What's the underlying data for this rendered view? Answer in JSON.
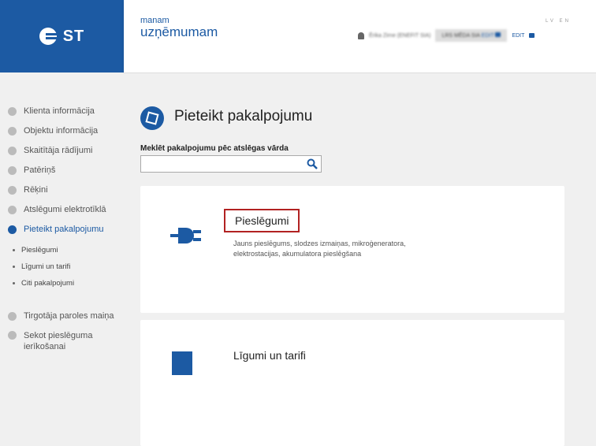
{
  "logo": {
    "text": "ST"
  },
  "header": {
    "brand_small": "manam",
    "brand_big": "uzņēmumam",
    "user_name": "Ērika Zirne (ENEFIT SIA)",
    "company": "LRS MĒDA SIA",
    "edit_label": "EDIT",
    "logout_label": "EDIT",
    "languages": "LV EN"
  },
  "sidebar": {
    "items": [
      {
        "label": "Klienta informācija",
        "icon": "document-icon"
      },
      {
        "label": "Objektu informācija",
        "icon": "info-icon"
      },
      {
        "label": "Skaitītāja rādījumi",
        "icon": "gauge-icon"
      },
      {
        "label": "Patēriņš",
        "icon": "flame-icon"
      },
      {
        "label": "Rēķini",
        "icon": "stack-icon"
      },
      {
        "label": "Atslēgumi elektrotīklā",
        "icon": "lightning-icon"
      },
      {
        "label": "Pieteikt pakalpojumu",
        "icon": "eye-icon"
      }
    ],
    "sub_items": [
      "Pieslēgumi",
      "Līgumi un tarifi",
      "Citi pakalpojumi"
    ],
    "lower_items": [
      {
        "label": "Tirgotāja paroles maiņa",
        "icon": "eye-icon"
      },
      {
        "label": "Sekot pieslēguma ierīkošanai",
        "icon": "eye-icon"
      }
    ]
  },
  "main": {
    "title": "Pieteikt pakalpojumu",
    "title_icon": "cube-icon",
    "search_label": "Meklēt pakalpojumu pēc atslēgas vārda",
    "search_placeholder": "",
    "cards": [
      {
        "title": "Pieslēgumi",
        "icon": "plug-icon",
        "description": "Jauns pieslēgums, slodzes izmaiņas, mikroģeneratora, elektrostacijas, akumulatora pieslēgšana"
      },
      {
        "title": "Līgumi un tarifi",
        "icon": "document-icon",
        "description": ""
      }
    ]
  },
  "colors": {
    "brand": "#1c5aa3",
    "highlight": "#b22222"
  }
}
